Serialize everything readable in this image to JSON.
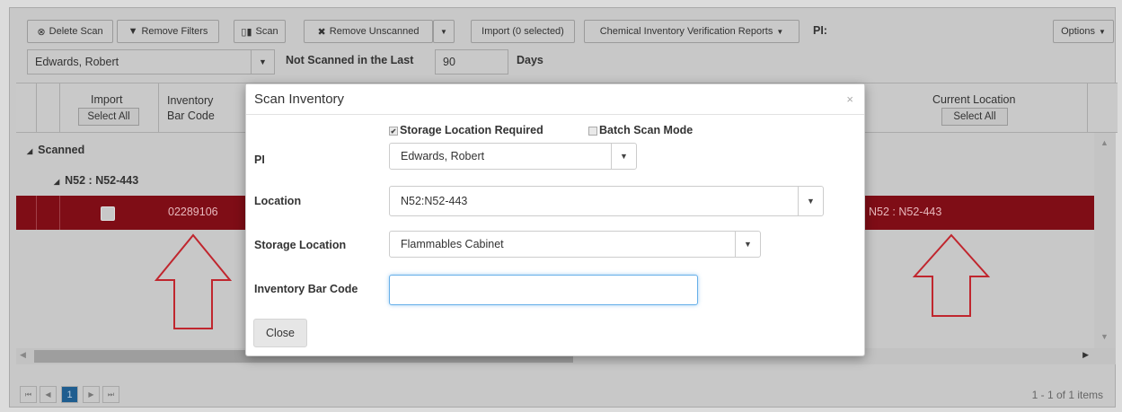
{
  "toolbar": {
    "delete_scan": "Delete Scan",
    "remove_filters": "Remove Filters",
    "scan": "Scan",
    "remove_unscanned": "Remove Unscanned",
    "import_selected": "Import (0 selected)",
    "reports": "Chemical Inventory Verification Reports",
    "pi_label": "PI:",
    "options": "Options",
    "pi_value": "Edwards, Robert",
    "not_scanned_label": "Not Scanned in the Last",
    "days_value": "90",
    "days_label": "Days"
  },
  "grid": {
    "col_import": "Import",
    "col_import_btn": "Select All",
    "col_barcode": "Inventory Bar Code",
    "col_location": "Current Location",
    "col_location_btn": "Select All",
    "group_scanned": "Scanned",
    "group_location": "N52 : N52-443",
    "row_barcode": "02289106",
    "row_location": "N52 : N52-443"
  },
  "modal": {
    "title": "Scan Inventory",
    "close_x": "×",
    "storage_required_label": "Storage Location Required",
    "storage_required_checked": true,
    "batch_mode_label": "Batch Scan Mode",
    "batch_mode_checked": false,
    "pi_label": "PI",
    "pi_value": "Edwards, Robert",
    "location_label": "Location",
    "location_value": "N52:N52-443",
    "storage_label": "Storage Location",
    "storage_value": "Flammables Cabinet",
    "barcode_label": "Inventory Bar Code",
    "barcode_value": "",
    "close_button": "Close"
  },
  "pager": {
    "current_page": "1",
    "summary": "1 - 1 of 1 items"
  },
  "colors": {
    "selected_row": "#7f0d16",
    "annotation_arrow": "#c0262e",
    "overlay": "#c8c8c8"
  }
}
